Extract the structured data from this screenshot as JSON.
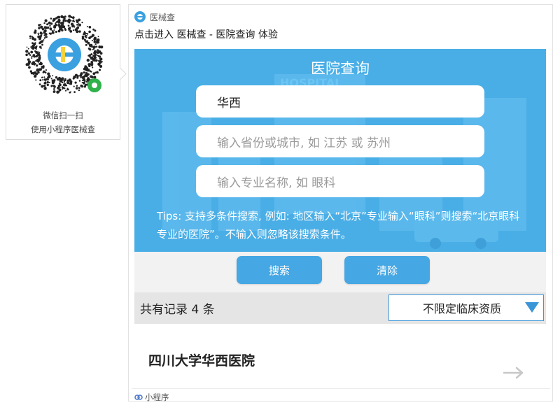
{
  "qr": {
    "caption_line1": "微信扫一扫",
    "caption_line2": "使用小程序医械查"
  },
  "card": {
    "brand_name": "医械查",
    "title": "点击进入 医械查 - 医院查询 体验"
  },
  "banner": {
    "title": "医院查询",
    "hospital_name_value": "华西",
    "region_placeholder": "输入省份或城市, 如 江苏 或 苏州",
    "specialty_placeholder": "输入专业名称, 如 眼科",
    "tips": "Tips: 支持多条件搜索, 例如: 地区输入“北京”专业输入“眼科”则搜索“北京眼科专业的医院”。不输入则忽略该搜索条件。",
    "bg_text": "HOSPITAL"
  },
  "actions": {
    "search_label": "搜索",
    "clear_label": "清除"
  },
  "records": {
    "count_label": "共有记录 4 条",
    "filter_selected": "不限定临床资质"
  },
  "results": [
    {
      "name": "四川大学华西医院"
    }
  ],
  "footer": {
    "label": "小程序"
  },
  "colors": {
    "banner_blue": "#4aaee6",
    "button_blue": "#45a7e3",
    "select_border": "#3b96d8",
    "brand_green": "#2fb24a"
  }
}
